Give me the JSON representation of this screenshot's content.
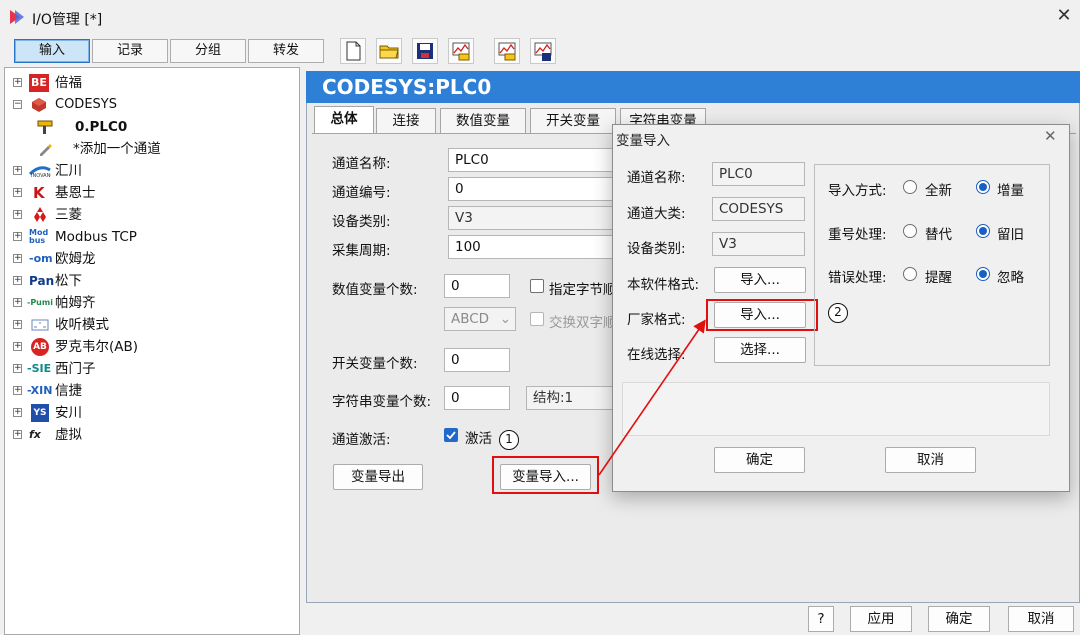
{
  "window": {
    "title": "I/O管理 [*]",
    "close_glyph": "✕"
  },
  "toolbar": {
    "tabs": [
      "输入",
      "记录",
      "分组",
      "转发"
    ],
    "icons": [
      "new-file-icon",
      "open-folder-icon",
      "save-icon",
      "import-chart-icon",
      "export-chart-icon",
      "print-chart-icon"
    ]
  },
  "tree": {
    "items": [
      {
        "label": "倍福",
        "brand": "BE",
        "icon": "beckhoff-logo-icon"
      },
      {
        "label": "CODESYS",
        "icon": "codesys-logo-icon"
      },
      {
        "label": "0.PLC0",
        "icon": "plc-device-icon"
      },
      {
        "label": "*添加一个通道"
      },
      {
        "label": "汇川",
        "icon": "inovance-logo-icon"
      },
      {
        "label": "基恩士",
        "brand": "K",
        "icon": "keyence-logo-icon"
      },
      {
        "label": "三菱",
        "icon": "mitsubishi-logo-icon"
      },
      {
        "label": "Modbus TCP",
        "brand": "Mod bus",
        "icon": "modbus-logo-icon"
      },
      {
        "label": "欧姆龙",
        "brand": "-om",
        "icon": "omron-logo-icon"
      },
      {
        "label": "松下",
        "brand": "Pan",
        "icon": "panasonic-logo-icon"
      },
      {
        "label": "帕姆齐",
        "brand": "-Pumi",
        "icon": "pumi-logo-icon"
      },
      {
        "label": "收听模式",
        "icon": "listen-mode-icon"
      },
      {
        "label": "罗克韦尔(AB)",
        "brand": "AB",
        "icon": "rockwell-logo-icon"
      },
      {
        "label": "西门子",
        "brand": "-SIE",
        "icon": "siemens-logo-icon"
      },
      {
        "label": "信捷",
        "brand": "-XIN",
        "icon": "xinje-logo-icon"
      },
      {
        "label": "安川",
        "brand": "YS",
        "icon": "yaskawa-logo-icon"
      },
      {
        "label": "虚拟",
        "brand": "fx",
        "icon": "virtual-icon"
      }
    ]
  },
  "header": {
    "title": "CODESYS:PLC0",
    "color": "#2e7fd6"
  },
  "tabs": [
    "总体",
    "连接",
    "数值变量",
    "开关变量",
    "字符串变量"
  ],
  "form": {
    "channel_name_label": "通道名称:",
    "channel_name": "PLC0",
    "channel_no_label": "通道编号:",
    "channel_no": "0",
    "device_type_label": "设备类别:",
    "device_type": "V3",
    "period_label": "采集周期:",
    "period": "100",
    "num_count_label": "数值变量个数:",
    "num_count": "0",
    "byte_order_label": "指定字节顺",
    "byte_order_value": "ABCD",
    "swap_label": "交换双字顺",
    "switch_count_label": "开关变量个数:",
    "switch_count": "0",
    "string_count_label": "字符串变量个数:",
    "string_count": "0",
    "structure_value": "结构:1",
    "activate_label": "通道激活:",
    "activate_check_label": "激活",
    "export_button": "变量导出",
    "import_button": "变量导入..."
  },
  "markers": {
    "first": "1",
    "second": "2"
  },
  "dialog": {
    "title": "变量导入",
    "channel_name_label": "通道名称:",
    "channel_name": "PLC0",
    "channel_class_label": "通道大类:",
    "channel_class": "CODESYS",
    "device_type_label": "设备类别:",
    "device_type": "V3",
    "own_format_label": "本软件格式:",
    "vendor_format_label": "厂家格式:",
    "online_label": "在线选择:",
    "import_button": "导入...",
    "vendor_import_button": "导入...",
    "select_button": "选择...",
    "import_mode_label": "导入方式:",
    "import_mode_options": [
      "全新",
      "增量"
    ],
    "import_mode_selected": "增量",
    "dup_label": "重号处理:",
    "dup_options": [
      "替代",
      "留旧"
    ],
    "dup_selected": "留旧",
    "err_label": "错误处理:",
    "err_options": [
      "提醒",
      "忽略"
    ],
    "err_selected": "忽略",
    "ok_button": "确定",
    "cancel_button": "取消"
  },
  "bottom": {
    "help": "?",
    "apply": "应用",
    "ok": "确定",
    "cancel": "取消"
  },
  "colors": {
    "accent": "#2e7fd6",
    "highlight_red": "#e01010"
  }
}
